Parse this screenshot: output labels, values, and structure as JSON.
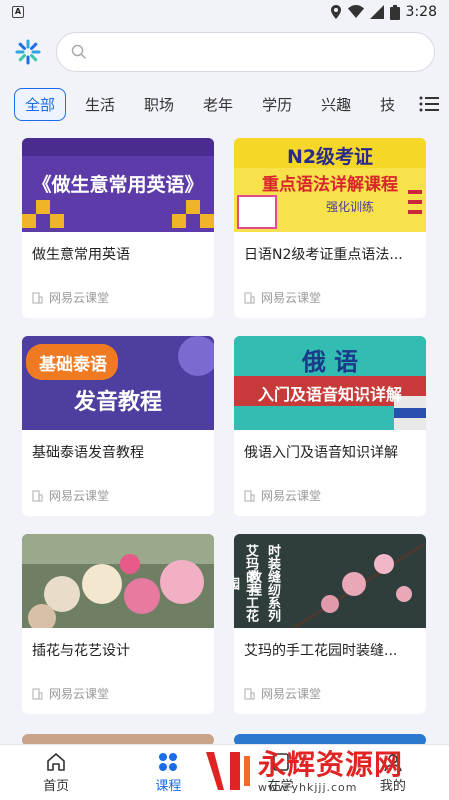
{
  "status_bar": {
    "time": "3:28"
  },
  "search": {
    "placeholder": ""
  },
  "tabs": [
    "全部",
    "生活",
    "职场",
    "老年",
    "学历",
    "兴趣",
    "技"
  ],
  "courses": [
    {
      "title": "做生意常用英语",
      "source": "网易云课堂",
      "thumb_text": "《做生意常用英语》"
    },
    {
      "title": "日语N2级考证重点语法...",
      "source": "网易云课堂",
      "thumb_text": "N2级考证",
      "thumb_sub": "重点语法详解课程",
      "thumb_sub2": "强化训练"
    },
    {
      "title": "基础泰语发音教程",
      "source": "网易云课堂",
      "thumb_text": "基础泰语",
      "thumb_sub": "发音教程"
    },
    {
      "title": "俄语入门及语音知识详解",
      "source": "网易云课堂",
      "thumb_text": "俄 语",
      "thumb_sub": "入门及语音知识详解"
    },
    {
      "title": "插花与花艺设计",
      "source": "网易云课堂"
    },
    {
      "title": "艾玛的手工花园时装缝...",
      "source": "网易云课堂",
      "thumb_text": "艾玛的手工花园",
      "thumb_sub": "时装缝纫系列教程"
    }
  ],
  "nav": [
    {
      "label": "首页",
      "icon": "home-icon"
    },
    {
      "label": "课程",
      "icon": "course-icon"
    },
    {
      "label": "在学",
      "icon": "learning-icon"
    },
    {
      "label": "我的",
      "icon": "profile-icon"
    }
  ],
  "watermark": {
    "brand": "永辉资源网",
    "url": "www.yhkjjj.com"
  },
  "colors": {
    "accent": "#1a6ce8",
    "background": "#f1f3f8",
    "watermark": "#e02424"
  }
}
